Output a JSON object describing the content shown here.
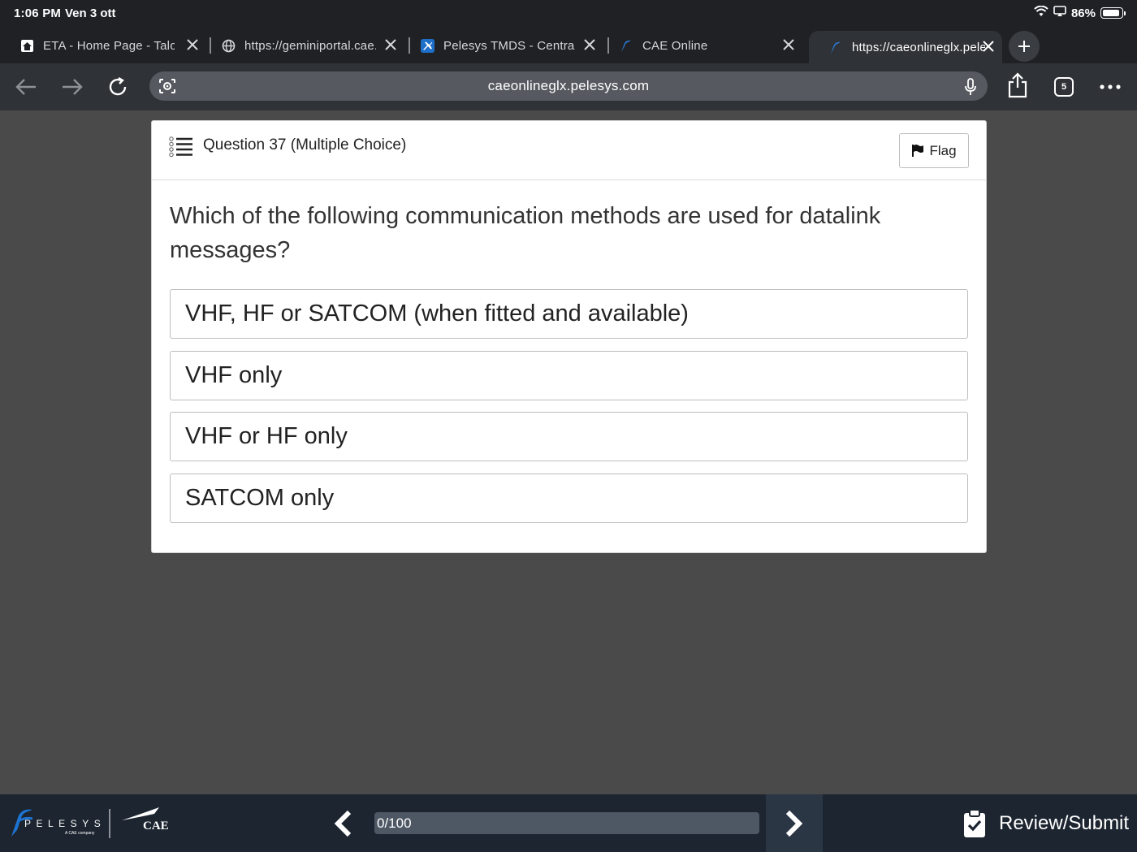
{
  "status": {
    "time": "1:06 PM",
    "date": "Ven 3 ott",
    "battery": "86%"
  },
  "tabs": [
    {
      "title": "ETA - Home Page - Talon",
      "icon": "home-icon",
      "active": false
    },
    {
      "title": "https://geminiportal.cae.com",
      "icon": "globe-icon",
      "active": false
    },
    {
      "title": "Pelesys TMDS - Central",
      "icon": "plane-icon",
      "active": false
    },
    {
      "title": "CAE Online",
      "icon": "pelesys-icon",
      "active": false
    },
    {
      "title": "https://caeonlineglx.pelesys.com",
      "icon": "pelesys-icon",
      "active": true
    }
  ],
  "toolbar": {
    "url": "caeonlineglx.pelesys.com",
    "tab_count": "5"
  },
  "question": {
    "header": "Question 37 (Multiple Choice)",
    "flag_label": "Flag",
    "text": "Which of the following communication methods are used for datalink messages?",
    "options": [
      "VHF, HF or SATCOM (when fitted and available)",
      "VHF only",
      "VHF or HF only",
      "SATCOM only"
    ]
  },
  "footer": {
    "brand_pelesys": "PELESYS",
    "brand_tagline": "A CAE company",
    "brand_cae": "CAE",
    "progress_text": "0/100",
    "progress_fraction": 0,
    "review_label": "Review/Submit"
  }
}
